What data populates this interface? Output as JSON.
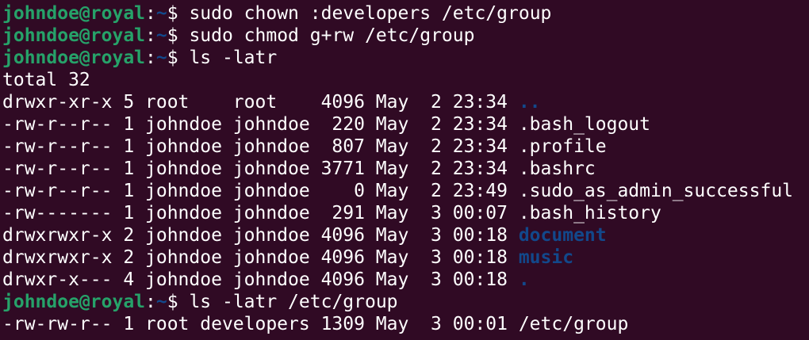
{
  "theme": {
    "background": "#300a24",
    "foreground": "#ffffff",
    "prompt_user_color": "#26a269",
    "prompt_path_color": "#12488b",
    "directory_color": "#12488b"
  },
  "prompt": {
    "user_host": "johndoe@royal",
    "colon": ":",
    "path": "~",
    "symbol": "$ "
  },
  "lines": [
    {
      "type": "command",
      "text": "sudo chown :developers /etc/group"
    },
    {
      "type": "command",
      "text": "sudo chmod g+rw /etc/group"
    },
    {
      "type": "command",
      "text": "ls -latr"
    },
    {
      "type": "output",
      "text": "total 32"
    },
    {
      "type": "listing",
      "meta": "drwxr-xr-x 5 root    root    4096 May  2 23:34 ",
      "name": "..",
      "is_dir": true
    },
    {
      "type": "listing",
      "meta": "-rw-r--r-- 1 johndoe johndoe  220 May  2 23:34 ",
      "name": ".bash_logout",
      "is_dir": false
    },
    {
      "type": "listing",
      "meta": "-rw-r--r-- 1 johndoe johndoe  807 May  2 23:34 ",
      "name": ".profile",
      "is_dir": false
    },
    {
      "type": "listing",
      "meta": "-rw-r--r-- 1 johndoe johndoe 3771 May  2 23:34 ",
      "name": ".bashrc",
      "is_dir": false
    },
    {
      "type": "listing",
      "meta": "-rw-r--r-- 1 johndoe johndoe    0 May  2 23:49 ",
      "name": ".sudo_as_admin_successful",
      "is_dir": false
    },
    {
      "type": "listing",
      "meta": "-rw------- 1 johndoe johndoe  291 May  3 00:07 ",
      "name": ".bash_history",
      "is_dir": false
    },
    {
      "type": "listing",
      "meta": "drwxrwxr-x 2 johndoe johndoe 4096 May  3 00:18 ",
      "name": "document",
      "is_dir": true
    },
    {
      "type": "listing",
      "meta": "drwxrwxr-x 2 johndoe johndoe 4096 May  3 00:18 ",
      "name": "music",
      "is_dir": true
    },
    {
      "type": "listing",
      "meta": "drwxr-x--- 4 johndoe johndoe 4096 May  3 00:18 ",
      "name": ".",
      "is_dir": true
    },
    {
      "type": "command",
      "text": "ls -latr /etc/group"
    },
    {
      "type": "listing",
      "meta": "-rw-rw-r-- 1 root developers 1309 May  3 00:01 ",
      "name": "/etc/group",
      "is_dir": false
    }
  ]
}
